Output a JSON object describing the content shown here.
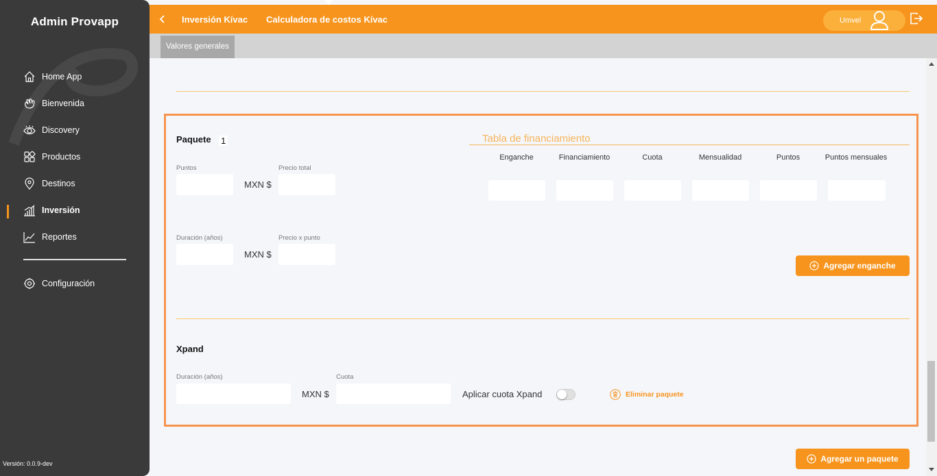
{
  "sidebar": {
    "brand": "Admin Provapp",
    "items": [
      {
        "label": "Home App",
        "icon": "home-icon"
      },
      {
        "label": "Bienvenida",
        "icon": "waving-hand-icon"
      },
      {
        "label": "Discovery",
        "icon": "eye-icon"
      },
      {
        "label": "Productos",
        "icon": "grid-icon"
      },
      {
        "label": "Destinos",
        "icon": "map-pin-icon"
      },
      {
        "label": "Inversión",
        "icon": "bar-chart-icon",
        "active": true
      },
      {
        "label": "Reportes",
        "icon": "line-chart-icon"
      }
    ],
    "settings": {
      "label": "Configuración",
      "icon": "gear-icon"
    },
    "version": "Versión: 0.0.9-dev"
  },
  "header": {
    "crumb1": "Inversión Kívac",
    "crumb2": "Calculadora de costos Kívac",
    "user": "Umvel"
  },
  "tabs": {
    "active": "Valores generales"
  },
  "package": {
    "title": "Paquete",
    "number": "1",
    "puntos_label": "Puntos",
    "precio_total_label": "Precio total",
    "duracion_label": "Duración (años)",
    "precio_punto_label": "Precio x punto",
    "currency": "MXN $"
  },
  "financing": {
    "title": "Tabla de financiamiento",
    "columns": [
      "Enganche",
      "Financiamiento",
      "Cuota",
      "Mensualidad",
      "Puntos",
      "Puntos mensuales"
    ],
    "add_button": "Agregar enganche"
  },
  "xpand": {
    "title": "Xpand",
    "duracion_label": "Duración (años)",
    "cuota_label": "Cuota",
    "currency": "MXN $",
    "apply_label": "Aplicar cuota Xpand",
    "delete_label": "Eliminar paquete"
  },
  "footer": {
    "add_package": "Agregar un paquete"
  },
  "colors": {
    "accent": "#f7941d",
    "sidebar": "#3a3a3a",
    "card_border": "#f7934d"
  }
}
